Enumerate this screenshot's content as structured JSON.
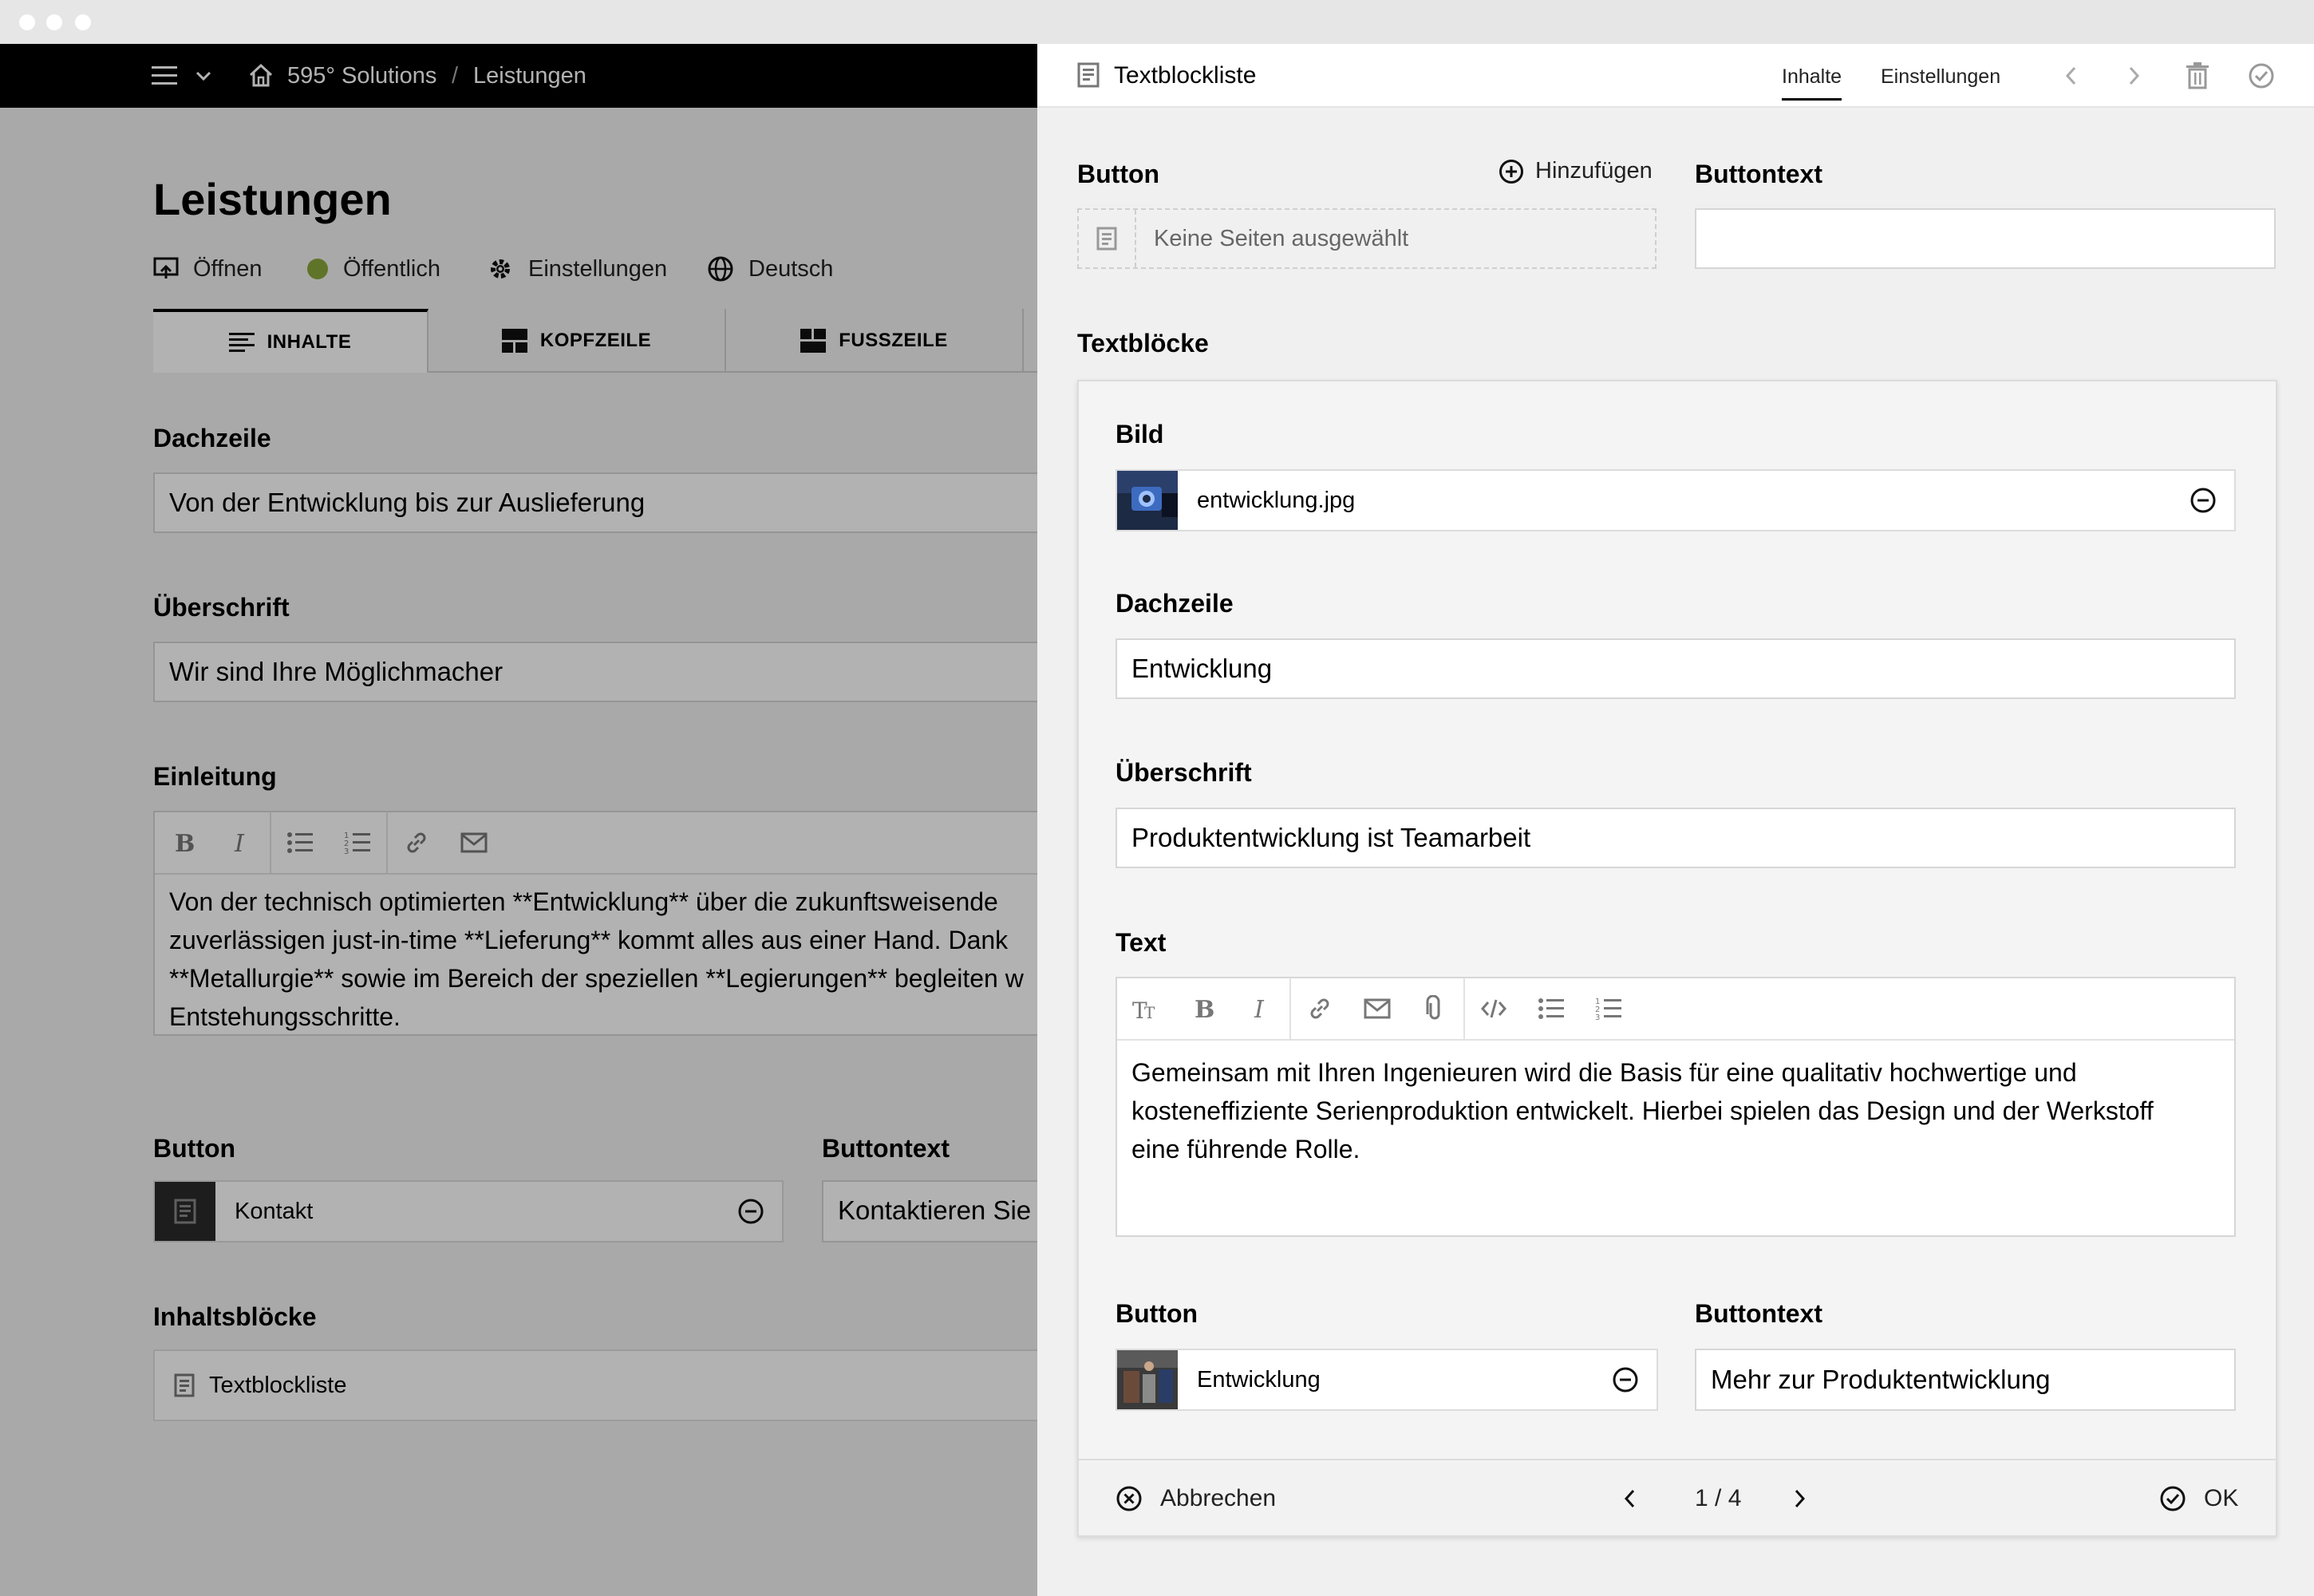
{
  "breadcrumb": {
    "site": "595° Solutions",
    "separator": "/",
    "page": "Leistungen"
  },
  "page": {
    "title": "Leistungen",
    "meta": {
      "open": "Öffnen",
      "status": "Öffentlich",
      "status_color": "#8aa63c",
      "settings": "Einstellungen",
      "language": "Deutsch"
    },
    "tabs": [
      {
        "label": "INHALTE"
      },
      {
        "label": "KOPFZEILE"
      },
      {
        "label": "FUSSZEILE"
      }
    ],
    "fields": {
      "dachzeile": {
        "label": "Dachzeile",
        "value": "Von der Entwicklung bis zur Auslieferung"
      },
      "ueberschrift": {
        "label": "Überschrift",
        "value": "Wir sind Ihre Möglichmacher"
      },
      "einleitung": {
        "label": "Einleitung",
        "value": "Von der technisch optimierten **Entwicklung** über die zukunftsweisende\nzuverlässigen just-in-time **Lieferung** kommt alles aus einer Hand. Dank\n**Metallurgie** sowie im Bereich der speziellen **Legierungen** begleiten w\nEntstehungsschritte."
      },
      "button": {
        "label": "Button",
        "value": "Kontakt"
      },
      "buttontext": {
        "label": "Buttontext",
        "value": "Kontaktieren Sie u"
      },
      "inhaltsbloecke": {
        "label": "Inhaltsblöcke",
        "item": "Textblockliste"
      }
    }
  },
  "drawer": {
    "title": "Textblockliste",
    "tabs": {
      "content": "Inhalte",
      "settings": "Einstellungen"
    },
    "button_label": "Button",
    "add_label": "Hinzufügen",
    "no_pages": "Keine Seiten ausgewählt",
    "buttontext_label": "Buttontext",
    "buttontext_value": "",
    "textbloecke_label": "Textblöcke",
    "block": {
      "bild_label": "Bild",
      "bild_file": "entwicklung.jpg",
      "dachzeile_label": "Dachzeile",
      "dachzeile_value": "Entwicklung",
      "ueberschrift_label": "Überschrift",
      "ueberschrift_value": "Produktentwicklung ist Teamarbeit",
      "text_label": "Text",
      "text_value": "Gemeinsam mit Ihren Ingenieuren wird die Basis für eine qualitativ hochwertige und\nkosteneffiziente Serienproduktion entwickelt. Hierbei spielen das Design und der Werkstoff\neine führende Rolle.",
      "button_label": "Button",
      "button_value": "Entwicklung",
      "buttontext_label": "Buttontext",
      "buttontext_value": "Mehr zur Produktentwicklung"
    },
    "footer": {
      "cancel": "Abbrechen",
      "pagination": "1 / 4",
      "ok": "OK"
    }
  }
}
